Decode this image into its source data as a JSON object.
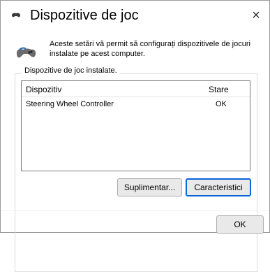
{
  "window": {
    "title": "Dispozitive de joc",
    "close_label": "×"
  },
  "header": {
    "description": "Aceste setări vă permit să configurați dispozitivele de jocuri instalate pe acest computer."
  },
  "group": {
    "label": "Dispozitive de joc instalate."
  },
  "list": {
    "columns": [
      "Dispozitiv",
      "Stare"
    ],
    "rows": [
      {
        "device": "Steering Wheel Controller",
        "status": "OK"
      }
    ]
  },
  "buttons": {
    "more": "Suplimentar...",
    "properties": "Caracteristici",
    "ok": "OK"
  },
  "icons": {
    "title_icon": "gamepad-icon",
    "header_icon": "gamepad-icon"
  },
  "colors": {
    "focus_accent": "#0a64d8"
  }
}
